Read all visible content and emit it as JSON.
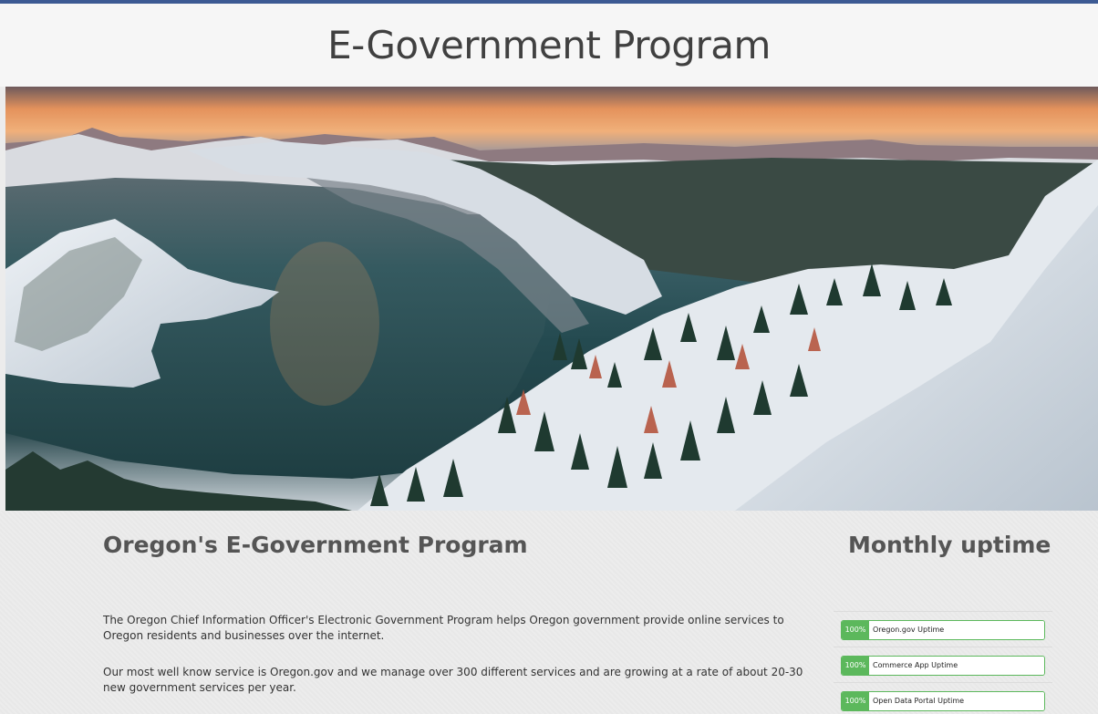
{
  "header": {
    "title": "E-Government Program"
  },
  "hero": {
    "image_alt": "Crater Lake winter panorama"
  },
  "main": {
    "title": "Oregon's E-Government Program",
    "paragraph1": "The Oregon Chief Information Officer's Electronic Government Program helps Oregon government provide online services to Oregon residents and businesses over the internet.",
    "paragraph2": "Our most well know service is Oregon.gov and we manage over 300 different services and are growing at a rate of about 20-30 new government services per year."
  },
  "sidebar": {
    "title": "Monthly uptime",
    "items": [
      {
        "percent_label": "100%",
        "label": "Oregon.gov Uptime",
        "value": 100
      },
      {
        "percent_label": "100%",
        "label": "Commerce App Uptime",
        "value": 100
      },
      {
        "percent_label": "100%",
        "label": "Open Data Portal Uptime",
        "value": 100
      }
    ]
  },
  "colors": {
    "top_bar": "#3c5a93",
    "progress": "#5cb85c",
    "heading": "#555555"
  }
}
